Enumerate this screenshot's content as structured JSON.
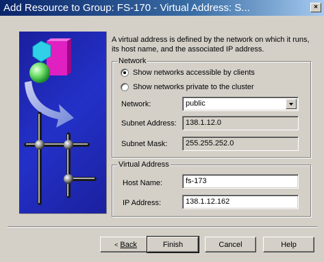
{
  "window": {
    "title": "Add Resource to Group: FS-170 - Virtual Address:  S...",
    "close_glyph": "×"
  },
  "description": "A virtual address is defined by the network on which it runs, its host name, and the associated IP address.",
  "network_group": {
    "legend": "Network",
    "radio_clients": {
      "label": "Show networks accessible by clients",
      "checked": true
    },
    "radio_private": {
      "label": "Show networks private to the cluster",
      "checked": false
    },
    "network_label": "Network:",
    "network_value": "public",
    "subnet_address_label": "Subnet Address:",
    "subnet_address_value": "138.1.12.0",
    "subnet_mask_label": "Subnet Mask:",
    "subnet_mask_value": "255.255.252.0"
  },
  "virtual_address_group": {
    "legend": "Virtual Address",
    "host_name_label": "Host Name:",
    "host_name_value": "fs-173",
    "ip_address_label": "IP Address:",
    "ip_address_value": "138.1.12.162"
  },
  "buttons": {
    "back_arrow": "<",
    "back": "Back",
    "finish": "Finish",
    "cancel": "Cancel",
    "help": "Help"
  },
  "colors": {
    "title_bar": "#0a246a",
    "dialog_bg": "#d4d0c8",
    "illustration_bg": "#2331c8"
  }
}
